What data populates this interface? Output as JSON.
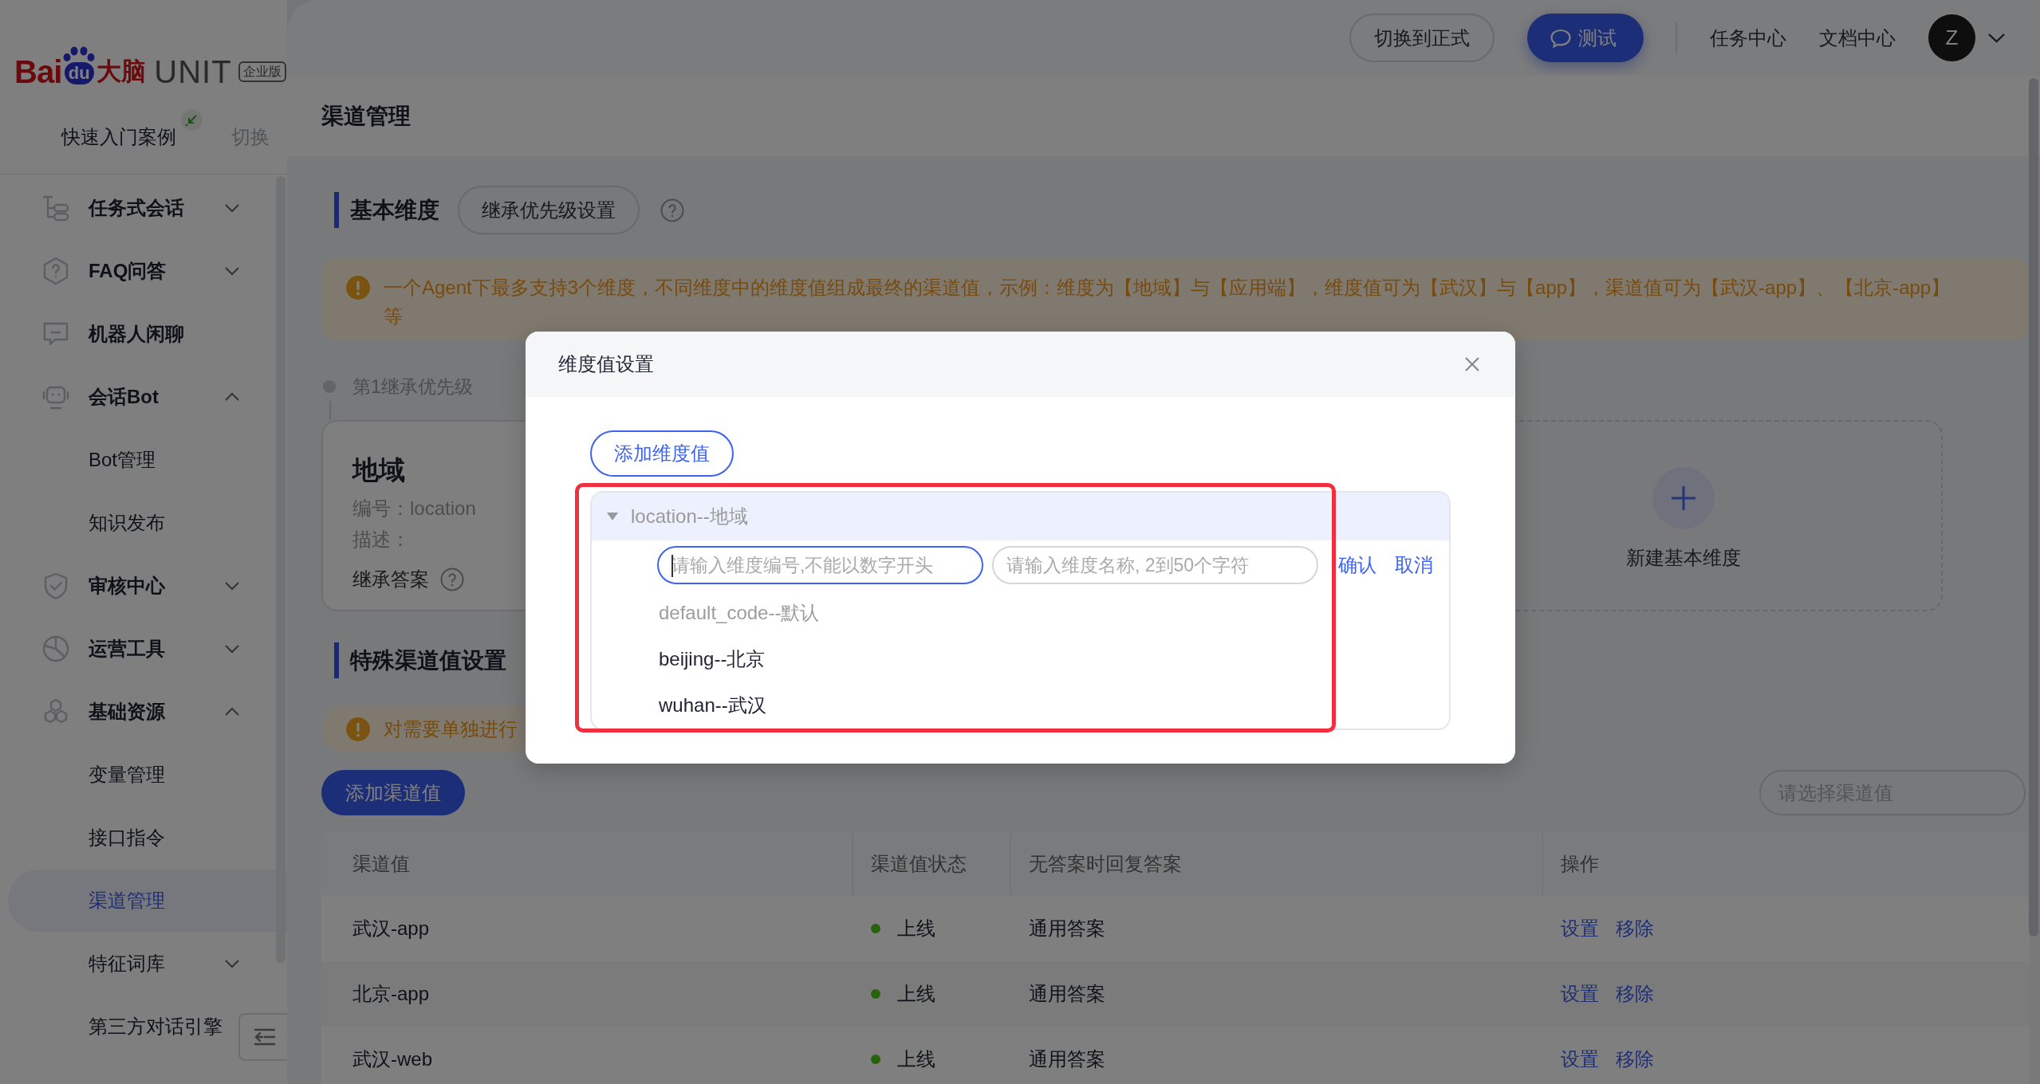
{
  "sidebar": {
    "logo": {
      "brand": "Bai",
      "mark": "du",
      "brand_cn": "大脑",
      "product": "UNIT",
      "edition": "企业版"
    },
    "quick_start": {
      "label": "快速入门案例",
      "switch": "切换"
    },
    "items": [
      {
        "label": "任务式会话",
        "selected": false,
        "expanded": false
      },
      {
        "label": "FAQ问答",
        "selected": false,
        "expanded": false
      },
      {
        "label": "机器人闲聊",
        "selected": false
      },
      {
        "label": "会话Bot",
        "selected": false,
        "expanded": true,
        "children": [
          {
            "label": "Bot管理",
            "selected": false
          },
          {
            "label": "知识发布",
            "selected": false
          }
        ]
      },
      {
        "label": "审核中心",
        "selected": false,
        "expanded": false
      },
      {
        "label": "运营工具",
        "selected": false,
        "expanded": false
      },
      {
        "label": "基础资源",
        "selected": false,
        "expanded": true,
        "children": [
          {
            "label": "变量管理",
            "selected": false
          },
          {
            "label": "接口指令",
            "selected": false
          },
          {
            "label": "渠道管理",
            "selected": true
          },
          {
            "label": "特征词库",
            "selected": false,
            "expanded": false
          },
          {
            "label": "第三方对话引擎",
            "selected": false
          }
        ]
      }
    ]
  },
  "header": {
    "buttons": [
      {
        "label": "切换到正式",
        "kind": "outline"
      },
      {
        "label": "测试",
        "kind": "primary"
      }
    ],
    "links": [
      "任务中心",
      "文档中心"
    ],
    "avatar": "Z"
  },
  "page": {
    "title": "渠道管理",
    "basic": {
      "heading": "基本维度",
      "priority_button": "继承优先级设置",
      "notice": "一个Agent下最多支持3个维度，不同维度中的维度值组成最终的渠道值，示例：维度为【地域】与【应用端】，维度值可为【武汉】与【app】，渠道值可为【武汉-app】、【北京-app】等",
      "levels": [
        {
          "label": "第1继承优先级",
          "name": "地域",
          "code": "编号：location",
          "description": "描述：",
          "inherit_label": "继承答案"
        }
      ],
      "new_dimension": "新建基本维度"
    },
    "special": {
      "heading": "特殊渠道值设置",
      "notice": "对需要单独进行",
      "add_button": "添加渠道值",
      "select": {
        "placeholder": "请选择渠道值"
      },
      "table": {
        "columns": [
          "渠道值",
          "渠道值状态",
          "无答案时回复答案",
          "操作"
        ],
        "rows": [
          {
            "channel": "武汉-app",
            "status": "上线",
            "online": true,
            "reply": "通用答案",
            "actions": [
              "设置",
              "移除"
            ]
          },
          {
            "channel": "北京-app",
            "status": "上线",
            "online": true,
            "reply": "通用答案",
            "actions": [
              "设置",
              "移除"
            ]
          },
          {
            "channel": "武汉-web",
            "status": "上线",
            "online": true,
            "reply": "通用答案",
            "actions": [
              "设置",
              "移除"
            ]
          }
        ]
      }
    }
  },
  "dialog": {
    "title": "维度值设置",
    "add_button": "添加维度值",
    "tree": {
      "label": "location--地域",
      "expanded": true,
      "editor": {
        "fields": [
          {
            "placeholder": "请输入维度编号,不能以数字开头",
            "focused": true
          },
          {
            "placeholder": "请输入维度名称, 2到50个字符",
            "focused": false
          }
        ],
        "confirm": "确认",
        "cancel": "取消"
      },
      "children": [
        {
          "label": "default_code--默认",
          "disabled": true
        },
        {
          "label": "beijing--北京",
          "disabled": false
        },
        {
          "label": "wuhan--武汉",
          "disabled": false
        }
      ]
    }
  }
}
